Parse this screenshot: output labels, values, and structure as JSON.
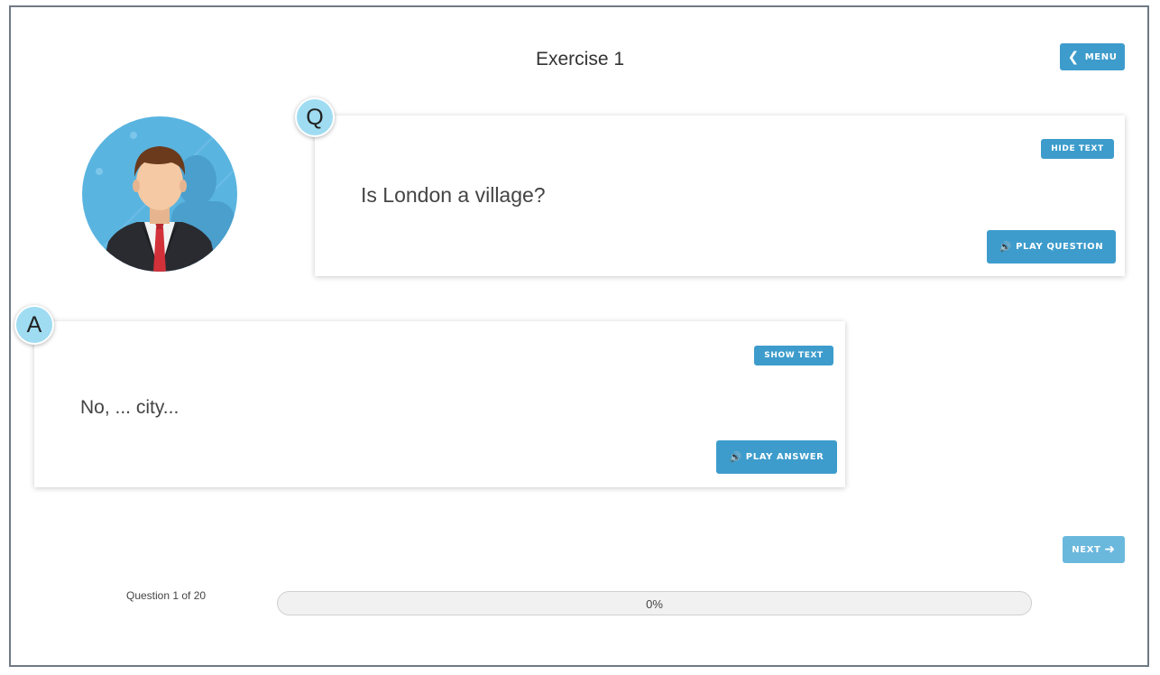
{
  "header": {
    "title": "Exercise 1",
    "menu_label": "MENU",
    "menu_icon": "chevron-left-icon"
  },
  "question": {
    "badge": "Q",
    "text": "Is London a village?",
    "toggle_text_label": "HIDE TEXT",
    "play_label": "PLAY QUESTION",
    "play_icon": "speaker-icon"
  },
  "answer": {
    "badge": "A",
    "text": "No, ... city...",
    "toggle_text_label": "SHOW TEXT",
    "play_label": "PLAY ANSWER",
    "play_icon": "speaker-icon"
  },
  "navigation": {
    "next_label": "NEXT",
    "next_icon": "arrow-right-icon"
  },
  "progress": {
    "counter_text": "Question 1 of 20",
    "percent_label": "0%",
    "value": 0
  },
  "colors": {
    "button": "#3d9ccc",
    "button_disabled": "#6bb8dd",
    "badge": "#9fdcf2",
    "avatar_bg": "#5ab4e0"
  }
}
